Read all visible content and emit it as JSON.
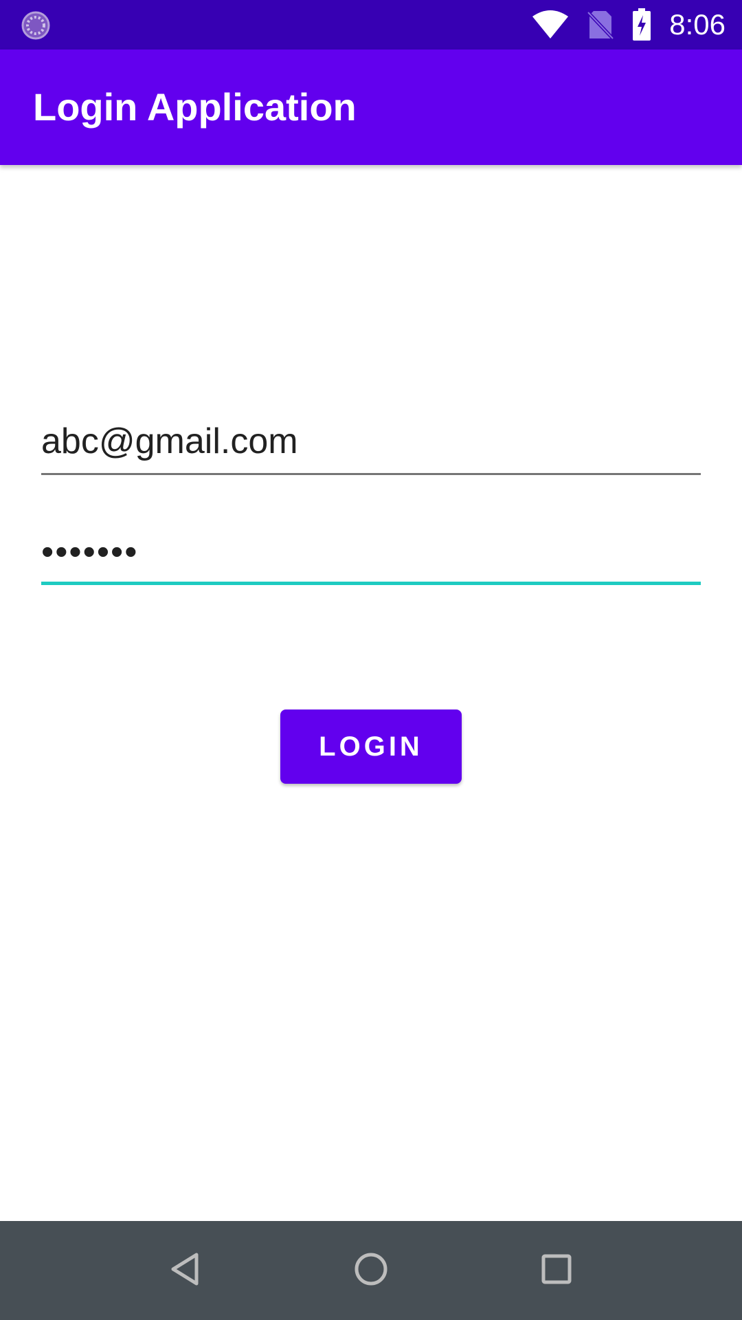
{
  "status_bar": {
    "time": "8:06",
    "icons": [
      "loading-icon",
      "wifi-icon",
      "no-sim-icon",
      "battery-charging-icon"
    ]
  },
  "app_bar": {
    "title": "Login Application"
  },
  "form": {
    "email_value": "abc@gmail.com",
    "password_value": "•••••••"
  },
  "login_button": {
    "label": "LOGIN"
  },
  "nav_bar": {
    "icons": [
      "back-icon",
      "home-icon",
      "recents-icon"
    ]
  },
  "colors": {
    "status_bar": "#3700b3",
    "primary": "#6200ee",
    "accent": "#1ecbc1",
    "nav_bar": "#474f55"
  }
}
